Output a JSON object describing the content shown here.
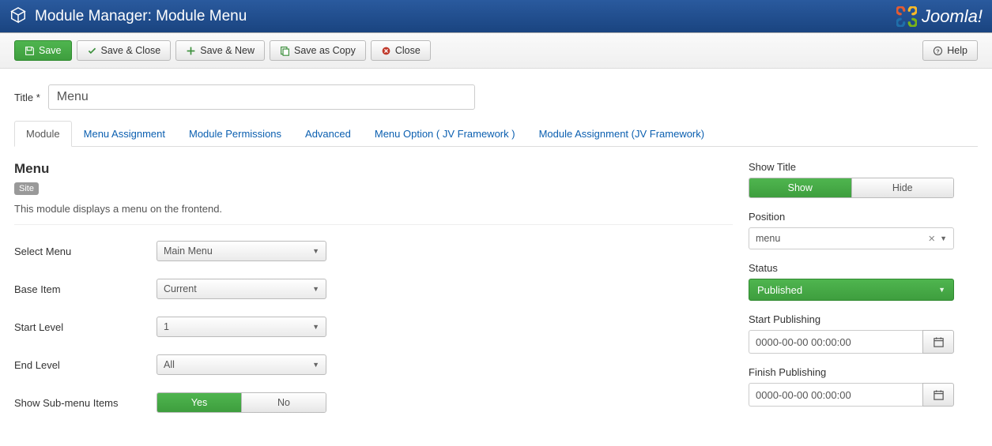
{
  "header": {
    "title": "Module Manager: Module Menu",
    "brand": "Joomla!"
  },
  "toolbar": {
    "save": "Save",
    "save_close": "Save & Close",
    "save_new": "Save & New",
    "save_copy": "Save as Copy",
    "close": "Close",
    "help": "Help"
  },
  "titleField": {
    "label": "Title *",
    "value": "Menu"
  },
  "tabs": [
    {
      "label": "Module",
      "active": true
    },
    {
      "label": "Menu Assignment"
    },
    {
      "label": "Module Permissions"
    },
    {
      "label": "Advanced"
    },
    {
      "label": "Menu Option ( JV Framework )"
    },
    {
      "label": "Module Assignment (JV Framework)"
    }
  ],
  "main": {
    "heading": "Menu",
    "badge": "Site",
    "desc": "This module displays a menu on the frontend.",
    "fields": {
      "select_menu": {
        "label": "Select Menu",
        "value": "Main Menu"
      },
      "base_item": {
        "label": "Base Item",
        "value": "Current"
      },
      "start_level": {
        "label": "Start Level",
        "value": "1"
      },
      "end_level": {
        "label": "End Level",
        "value": "All"
      },
      "show_sub": {
        "label": "Show Sub-menu Items",
        "yes": "Yes",
        "no": "No"
      }
    }
  },
  "side": {
    "show_title": {
      "label": "Show Title",
      "show": "Show",
      "hide": "Hide"
    },
    "position": {
      "label": "Position",
      "value": "menu"
    },
    "status": {
      "label": "Status",
      "value": "Published"
    },
    "start_pub": {
      "label": "Start Publishing",
      "value": "0000-00-00 00:00:00"
    },
    "finish_pub": {
      "label": "Finish Publishing",
      "value": "0000-00-00 00:00:00"
    }
  }
}
